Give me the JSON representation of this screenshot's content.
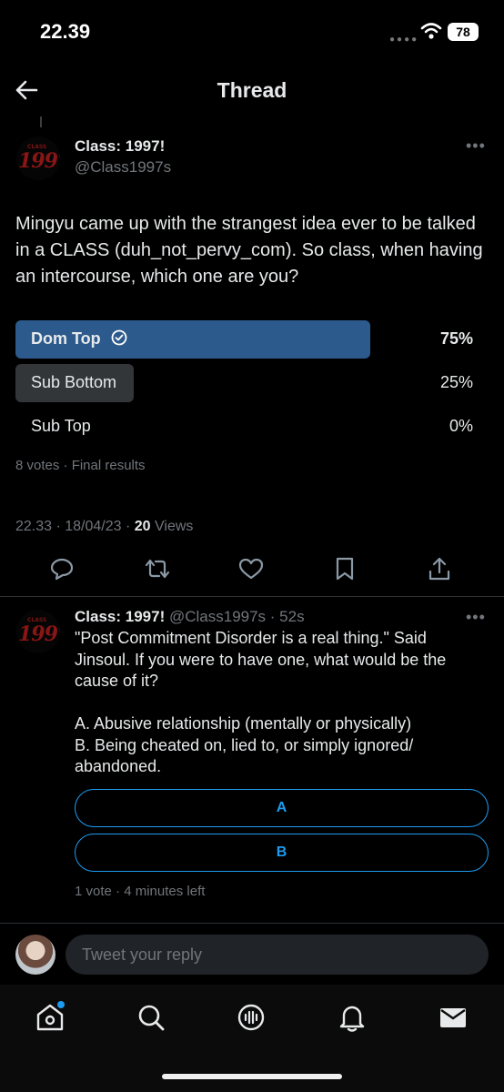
{
  "status_bar": {
    "time": "22.39",
    "battery": "78"
  },
  "header": {
    "title": "Thread"
  },
  "post": {
    "author_name": "Class: 1997!",
    "author_handle": "@Class1997s",
    "avatar_text_small": "CLASS",
    "avatar_text_big": "1997",
    "text": "Mingyu came up with the strangest idea ever to be talked in a CLASS (duh_not_pervy_com). So class, when having an intercourse, which one are you?",
    "poll": {
      "options": [
        {
          "label": "Dom Top",
          "percent_text": "75%",
          "percent": 75,
          "winner": true
        },
        {
          "label": "Sub Bottom",
          "percent_text": "25%",
          "percent": 25,
          "winner": false
        },
        {
          "label": "Sub Top",
          "percent_text": "0%",
          "percent": 0,
          "winner": false
        }
      ],
      "footer": "8 votes · Final results"
    },
    "timestamp": "22.33 · 18/04/23 · ",
    "views_count": "20",
    "views_label": " Views",
    "actions": [
      "reply-icon",
      "retweet-icon",
      "like-icon",
      "bookmark-icon",
      "share-icon"
    ]
  },
  "reply_post": {
    "author_name": "Class: 1997!",
    "author_handle": "@Class1997s",
    "time": "52s",
    "text_quote": "\"Post Commitment Disorder is a real thing.\" Said Jinsoul. If you were to have one, what would be the cause of it?",
    "text_option_a": "A. Abusive relationship (mentally or physically)",
    "text_option_b": "B. Being cheated on, lied to, or simply ignored/ abandoned.",
    "poll": {
      "options": [
        {
          "label": "A"
        },
        {
          "label": "B"
        }
      ],
      "footer": "1 vote · 4 minutes left"
    }
  },
  "reply_bar": {
    "placeholder": "Tweet your reply"
  },
  "tabs": [
    "home-icon",
    "search-icon",
    "spaces-icon",
    "notifications-icon",
    "messages-icon"
  ],
  "colors": {
    "accent": "#1d9bf0",
    "winner_bar": "#2c5a8c",
    "loser_bar": "#333639",
    "background": "#000000"
  }
}
